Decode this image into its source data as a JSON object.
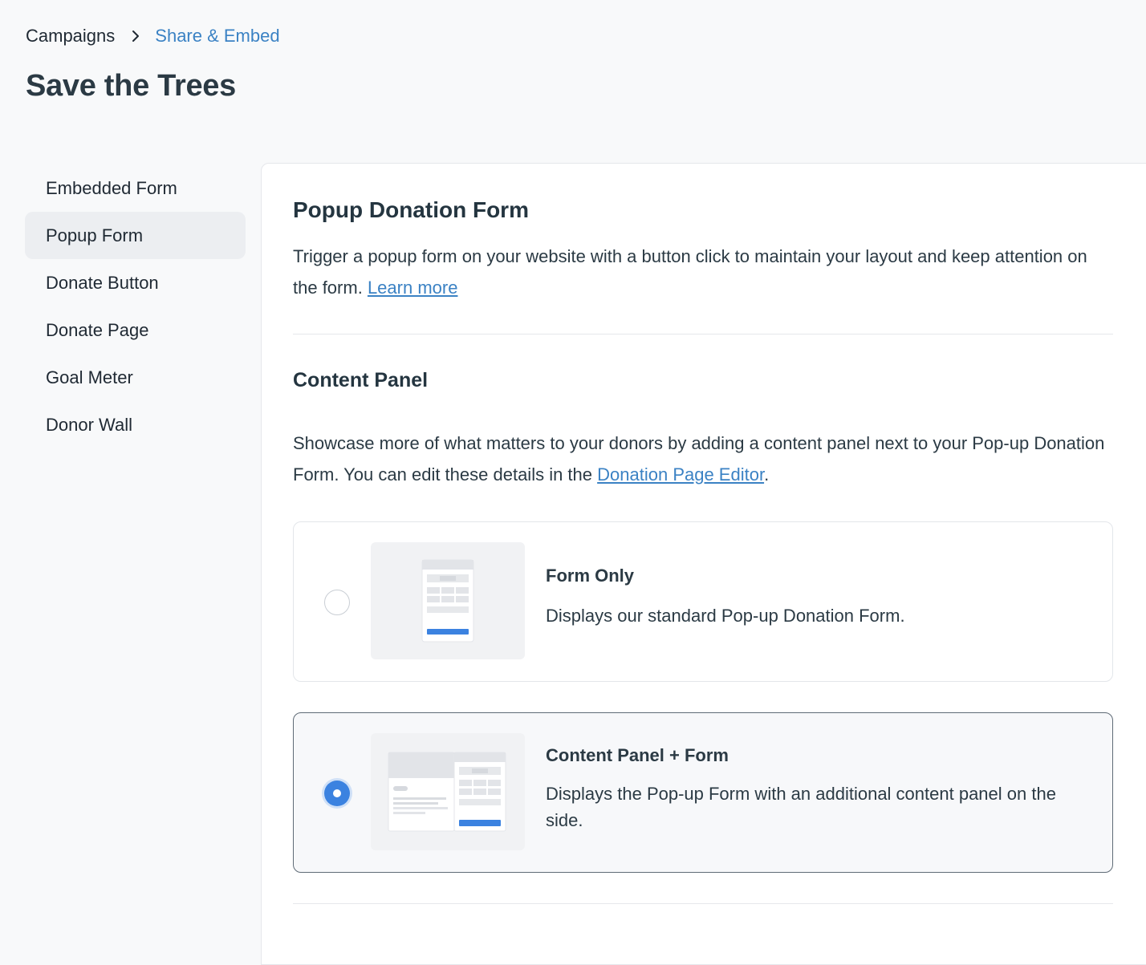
{
  "breadcrumb": {
    "root": "Campaigns",
    "current": "Share & Embed"
  },
  "page": {
    "title": "Save the Trees"
  },
  "sidebar": {
    "items": [
      {
        "label": "Embedded Form"
      },
      {
        "label": "Popup Form",
        "active": true
      },
      {
        "label": "Donate Button"
      },
      {
        "label": "Donate Page"
      },
      {
        "label": "Goal Meter"
      },
      {
        "label": "Donor Wall"
      }
    ]
  },
  "main": {
    "title": "Popup Donation Form",
    "description": "Trigger a popup form on your website with a button click to maintain your layout and keep attention on the form.",
    "learn_more": "Learn more",
    "content_panel": {
      "title": "Content Panel",
      "description_prefix": "Showcase more of what matters to your donors by adding a content panel next to your Pop-up Donation Form. You can edit these details in the",
      "editor_link": "Donation Page Editor",
      "description_suffix": "."
    },
    "options": [
      {
        "title": "Form Only",
        "description": "Displays our standard Pop-up Donation Form.",
        "selected": false
      },
      {
        "title": "Content Panel + Form",
        "description": "Displays the Pop-up Form with an additional content panel on the side.",
        "selected": true
      }
    ]
  },
  "colors": {
    "accent": "#3b82c4",
    "radio_selected": "#3b82e0",
    "active_nav_bg": "#eceef1"
  },
  "icons": {
    "breadcrumb_separator": "chevron-right-icon"
  }
}
